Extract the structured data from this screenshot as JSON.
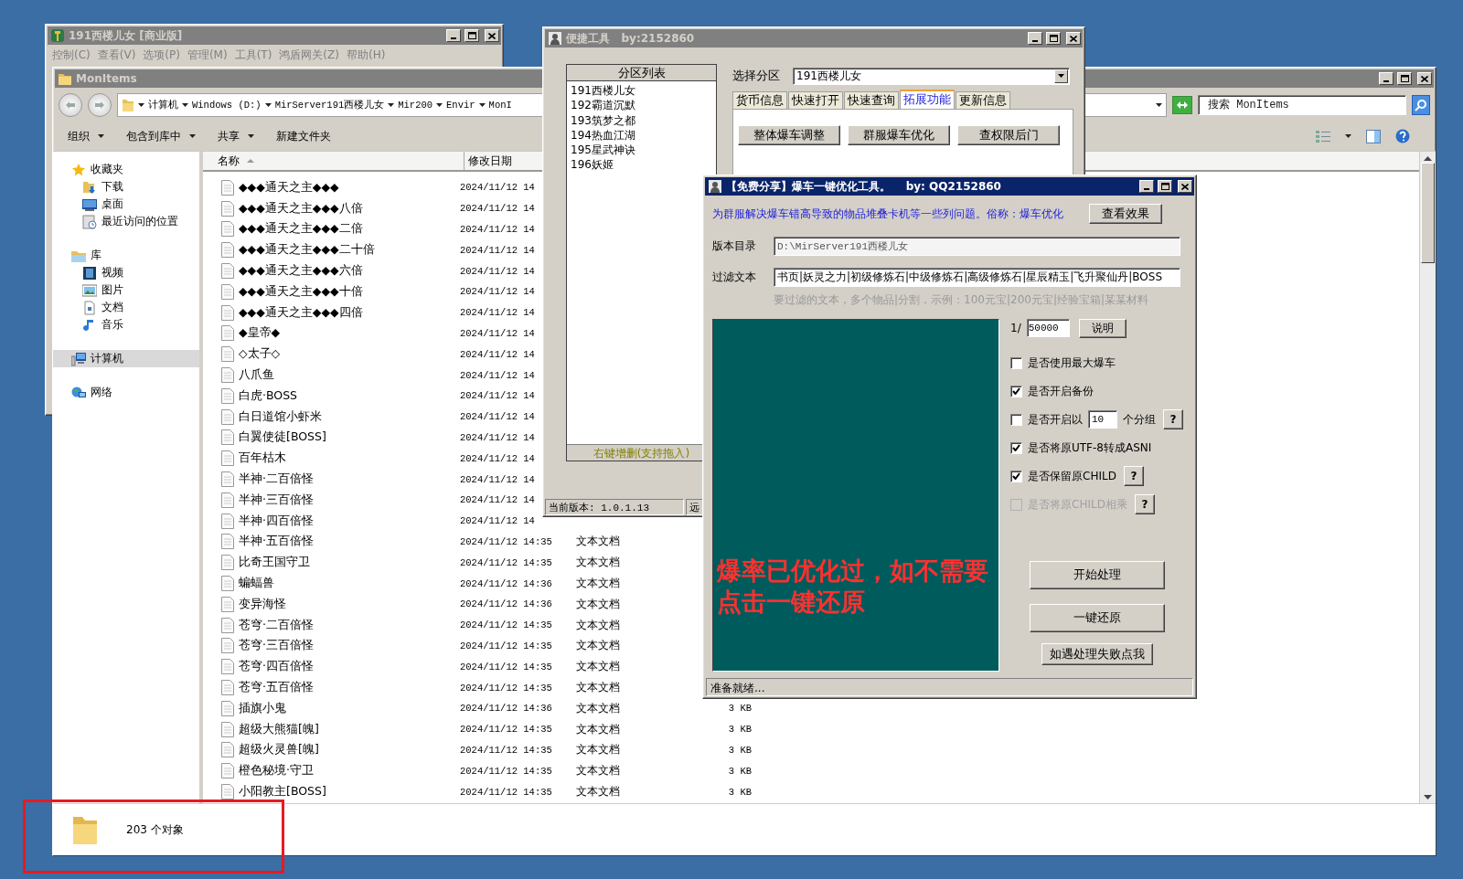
{
  "desktop": {
    "main_window": {
      "title": "191西楼儿女 [商业版]",
      "active": false,
      "menu": [
        "控制(C)",
        "查看(V)",
        "选项(P)",
        "管理(M)",
        "工具(T)",
        "鸿盾网关(Z)",
        "帮助(H)"
      ]
    },
    "explorer": {
      "title": "MonItems",
      "active": false,
      "address": [
        "计算机",
        "Windows (D:)",
        "MirServer191西楼儿女",
        "Mir200",
        "Envir",
        "MonI"
      ],
      "search": {
        "placeholder": "搜索 MonItems"
      },
      "toolbar": [
        {
          "label": "组织",
          "dropdown": true
        },
        {
          "label": "包含到库中",
          "dropdown": true
        },
        {
          "label": "共享",
          "dropdown": true
        },
        {
          "label": "新建文件夹",
          "dropdown": false
        }
      ],
      "sidebar": [
        {
          "label": "收藏夹",
          "kind": "star",
          "selected": false,
          "children": [
            {
              "label": "下载",
              "kind": "download",
              "selected": false
            },
            {
              "label": "桌面",
              "kind": "desktop",
              "selected": false
            },
            {
              "label": "最近访问的位置",
              "kind": "recent",
              "selected": false
            }
          ]
        },
        {
          "label": "库",
          "kind": "library",
          "selected": false,
          "children": [
            {
              "label": "视频",
              "kind": "video",
              "selected": false
            },
            {
              "label": "图片",
              "kind": "picture",
              "selected": false
            },
            {
              "label": "文档",
              "kind": "document",
              "selected": false
            },
            {
              "label": "音乐",
              "kind": "music",
              "selected": false
            }
          ]
        },
        {
          "label": "计算机",
          "kind": "computer",
          "selected": true
        },
        {
          "label": "网络",
          "kind": "network",
          "selected": false
        }
      ],
      "columns": [
        {
          "label": "名称",
          "sorted": true
        },
        {
          "label": "修改日期",
          "sorted": false
        }
      ],
      "rows": [
        {
          "name": "◆◆◆通天之主◆◆◆",
          "modified": "2024/11/12 14"
        },
        {
          "name": "◆◆◆通天之主◆◆◆八倍",
          "modified": "2024/11/12 14"
        },
        {
          "name": "◆◆◆通天之主◆◆◆二倍",
          "modified": "2024/11/12 14"
        },
        {
          "name": "◆◆◆通天之主◆◆◆二十倍",
          "modified": "2024/11/12 14"
        },
        {
          "name": "◆◆◆通天之主◆◆◆六倍",
          "modified": "2024/11/12 14"
        },
        {
          "name": "◆◆◆通天之主◆◆◆十倍",
          "modified": "2024/11/12 14"
        },
        {
          "name": "◆◆◆通天之主◆◆◆四倍",
          "modified": "2024/11/12 14"
        },
        {
          "name": "◆皇帝◆",
          "modified": "2024/11/12 14"
        },
        {
          "name": "◇太子◇",
          "modified": "2024/11/12 14"
        },
        {
          "name": "八爪鱼",
          "modified": "2024/11/12 14"
        },
        {
          "name": "白虎·BOSS",
          "modified": "2024/11/12 14"
        },
        {
          "name": "白日道馆小虾米",
          "modified": "2024/11/12 14"
        },
        {
          "name": "白翼使徒[BOSS]",
          "modified": "2024/11/12 14"
        },
        {
          "name": "百年枯木",
          "modified": "2024/11/12 14"
        },
        {
          "name": "半神·二百倍怪",
          "modified": "2024/11/12 14"
        },
        {
          "name": "半神·三百倍怪",
          "modified": "2024/11/12 14"
        },
        {
          "name": "半神·四百倍怪",
          "modified": "2024/11/12 14"
        },
        {
          "name": "半神·五百倍怪",
          "modified": "2024/11/12 14:35",
          "type": "文本文档"
        },
        {
          "name": "比奇王国守卫",
          "modified": "2024/11/12 14:35",
          "type": "文本文档"
        },
        {
          "name": "蝙蝠兽",
          "modified": "2024/11/12 14:36",
          "type": "文本文档"
        },
        {
          "name": "变异海怪",
          "modified": "2024/11/12 14:36",
          "type": "文本文档"
        },
        {
          "name": "苍穹·二百倍怪",
          "modified": "2024/11/12 14:35",
          "type": "文本文档"
        },
        {
          "name": "苍穹·三百倍怪",
          "modified": "2024/11/12 14:35",
          "type": "文本文档"
        },
        {
          "name": "苍穹·四百倍怪",
          "modified": "2024/11/12 14:35",
          "type": "文本文档"
        },
        {
          "name": "苍穹·五百倍怪",
          "modified": "2024/11/12 14:35",
          "type": "文本文档"
        },
        {
          "name": "插旗小鬼",
          "modified": "2024/11/12 14:36",
          "type": "文本文档",
          "size": "3 KB"
        },
        {
          "name": "超级大熊猫[魄]",
          "modified": "2024/11/12 14:35",
          "type": "文本文档",
          "size": "3 KB"
        },
        {
          "name": "超级火灵兽[魄]",
          "modified": "2024/11/12 14:35",
          "type": "文本文档",
          "size": "3 KB"
        },
        {
          "name": "橙色秘境·守卫",
          "modified": "2024/11/12 14:35",
          "type": "文本文档",
          "size": "3 KB"
        },
        {
          "name": "小阳教主[BOSS]",
          "modified": "2024/11/12 14:35",
          "type": "文本文档",
          "size": "3 KB"
        }
      ],
      "status": "203 个对象"
    },
    "tool_window": {
      "title": "便捷工具   by:2152860",
      "active": false,
      "partitions": {
        "header": "分区列表",
        "items": [
          {
            "label": "191西楼儿女",
            "selected": false
          },
          {
            "label": "192霸道沉默",
            "selected": false
          },
          {
            "label": "193筑梦之都",
            "selected": false
          },
          {
            "label": "194热血江湖",
            "selected": false
          },
          {
            "label": "195星武神诀",
            "selected": false
          },
          {
            "label": "196妖姬",
            "selected": false
          }
        ],
        "footer": "右键增删(支持拖入)"
      },
      "select_label": "选择分区",
      "select_value": "191西楼儿女",
      "tabs": [
        {
          "label": "货币信息",
          "selected": false
        },
        {
          "label": "快速打开",
          "selected": false
        },
        {
          "label": "快速查询",
          "selected": false
        },
        {
          "label": "拓展功能",
          "selected": true
        },
        {
          "label": "更新信息",
          "selected": false
        }
      ],
      "buttons": [
        "整体爆车调整",
        "群服爆车优化",
        "查权限后门"
      ],
      "status": [
        "当前版本: 1.0.1.13",
        "远"
      ]
    },
    "optimizer": {
      "title": "【免费分享】爆车一键优化工具。    by: QQ2152860",
      "active": true,
      "intro": "为群服解决爆车错高导致的物品堆叠卡机等一些列问题。俗称：爆车优化",
      "preview_button": "查看效果",
      "fields": [
        {
          "label": "版本目录",
          "value": "D:\\MirServer191西楼儿女",
          "disabled": true
        },
        {
          "label": "过滤文本",
          "value": "书页|妖灵之力|初级修炼石|中级修炼石|高级修炼石|星辰精玉|飞升聚仙丹|BOSS",
          "disabled": false
        }
      ],
      "hint": "要过滤的文本，多个物品|分割，示例：100元宝|200元宝|经验宝箱|某某材料",
      "notice": "爆率已优化过，如不需要点击一键还原",
      "ratio": {
        "label": "1/",
        "value": "50000",
        "button": "说明"
      },
      "options": [
        {
          "label": "是否使用最大爆车",
          "checked": false,
          "disabled": false
        },
        {
          "label": "是否开启备份",
          "checked": true,
          "disabled": false
        },
        {
          "label": "是否开启以",
          "checked": false,
          "disabled": false,
          "count": "10",
          "suffix": "个分组",
          "help": "?"
        },
        {
          "label": "是否将原UTF-8转成ASNI",
          "checked": true,
          "disabled": false
        },
        {
          "label": "是否保留原CHILD",
          "checked": true,
          "disabled": false,
          "help": "?"
        },
        {
          "label": "是否将原CHILD相乘",
          "checked": false,
          "disabled": true,
          "help": "?"
        }
      ],
      "actions": [
        "开始处理",
        "一键还原"
      ],
      "help_button": "如遇处理失败点我",
      "status": "准备就绪..."
    },
    "annotation": {
      "kind": "rectangle"
    }
  }
}
